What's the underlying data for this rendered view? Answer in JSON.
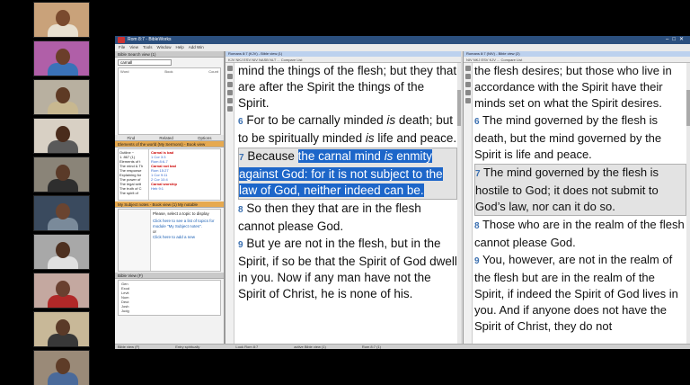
{
  "app": {
    "title": "Rom 8:7 - BibleWorks",
    "menu": [
      "File",
      "View",
      "Tools",
      "Window",
      "Help",
      "Add Win"
    ],
    "status": [
      "Bible view (F)",
      "Entry spiritually",
      "Look Rom 8:7",
      "active Bible view (1)",
      "Rom 8:7 (1)"
    ]
  },
  "left": {
    "search_title": "Bible Search view (1)",
    "search_value": "carnall",
    "search_cols": [
      "Word",
      "Book",
      "Count"
    ],
    "tabs": [
      "Find",
      "Related",
      "Options"
    ],
    "outline_title": "Elements of the world (My Sermons) - Book view",
    "outline_items": [
      "Outline ~",
      "1. 867 (1)",
      "Elements of t",
      "The mind & Th",
      "The response",
      "Explaining for",
      "The power of",
      "The legal sett",
      "The truth of C",
      "The spirit of"
    ],
    "refs": [
      {
        "label": "Carnal is bad",
        "kind": "red"
      },
      {
        "label": "1 Cor 3:3",
        "kind": "blue"
      },
      {
        "label": "Rom 8:6-7",
        "kind": "blue"
      },
      {
        "label": "Carnal not bad",
        "kind": "red"
      },
      {
        "label": "Rom 15:27",
        "kind": "blue"
      },
      {
        "label": "1 Cor 9:11",
        "kind": "blue"
      },
      {
        "label": "2 Cor 10:4",
        "kind": "blue"
      },
      {
        "label": "Carnal worship",
        "kind": "red"
      },
      {
        "label": "Heb 9:1",
        "kind": "blue"
      }
    ],
    "notes_title": "My Subject notes - Book view (1) My notable",
    "notes_text": "Please, select a topic to display",
    "notes_link1": "Click here to see a list of topics for module \"My Subject notes\".",
    "notes_or": "or",
    "notes_link2": "Click here to add a new",
    "bibles_title": "Bible View (F)",
    "bibles": [
      "Gen",
      "Exod",
      "Levit",
      "Num",
      "Deut",
      "Josh",
      "Judg"
    ]
  },
  "pane1": {
    "title": "Romans 8:7 (KJV) - Bible view (1)",
    "tools": "KJV  NKJ  ESV  NIV  NASB  NLT  ...  Compare  List",
    "verses": [
      {
        "num": "",
        "text": "mind the things of the flesh; but they that are after the Spirit the things of the Spirit."
      },
      {
        "num": "6",
        "pre": "For to be carnally minded ",
        "em": "is",
        "post": " death; but to be spiritually minded ",
        "em2": "is",
        "post2": " life and peace."
      },
      {
        "num": "7",
        "plain": "Because ",
        "selected_a": "the carnal mind ",
        "selected_em": "is",
        "selected_b": " enmity against God: for it is not subject to the law of God, neither indeed can be."
      },
      {
        "num": "8",
        "text": "So then they that are in the flesh cannot please God."
      },
      {
        "num": "9",
        "text": "But ye are not in the flesh, but in the Spirit, if so be that the Spirit of God dwell in you. Now if any man have not the Spirit of Christ, he is none of his."
      }
    ]
  },
  "pane2": {
    "title": "Romans 8:7 (NIV) - Bible view (2)",
    "tools": "NIV  NKJ  ESV  KJV  ...  Compare  List",
    "verses": [
      {
        "num": "",
        "text": "the flesh desires; but those who live in accordance with the Spirit have their minds set on what the Spirit desires."
      },
      {
        "num": "6",
        "text": "The mind governed by the flesh is death, but the mind governed by the Spirit is life and peace."
      },
      {
        "num": "7",
        "text": "The mind governed by the flesh is hostile to God; it does not submit to God’s law, nor can it do so."
      },
      {
        "num": "8",
        "text": "Those who are in the realm of the flesh cannot please God."
      },
      {
        "num": "9",
        "text": "You, however, are not in the realm of the flesh but are in the realm of the Spirit, if indeed the Spirit of God lives in you. And if anyone does not have the Spirit of Christ, they do not"
      }
    ]
  },
  "participants": [
    {
      "bg": "#c9a27a",
      "skin": "#7a4a2e",
      "shirt": "#e8e0d0"
    },
    {
      "bg": "#b05fa8",
      "skin": "#6b3e2a",
      "shirt": "#3a72b8"
    },
    {
      "bg": "#b8b0a0",
      "skin": "#5e3a24",
      "shirt": "#c8b890"
    },
    {
      "bg": "#d8d0c4",
      "skin": "#4a2c1c",
      "shirt": "#5a5a5a"
    },
    {
      "bg": "#8a8478",
      "skin": "#5a3a28",
      "shirt": "#2e2e2e"
    },
    {
      "bg": "#3a4a5e",
      "skin": "#6a4430",
      "shirt": "#7a8a9a"
    },
    {
      "bg": "#a8a8a8",
      "skin": "#4e3020",
      "shirt": "#e0e0e0"
    },
    {
      "bg": "#c4a8a0",
      "skin": "#6a4030",
      "shirt": "#b02828"
    },
    {
      "bg": "#c8b898",
      "skin": "#5a3a28",
      "shirt": "#383838"
    },
    {
      "bg": "#9a8a78",
      "skin": "#5e3c28",
      "shirt": "#4a6a9a"
    }
  ]
}
